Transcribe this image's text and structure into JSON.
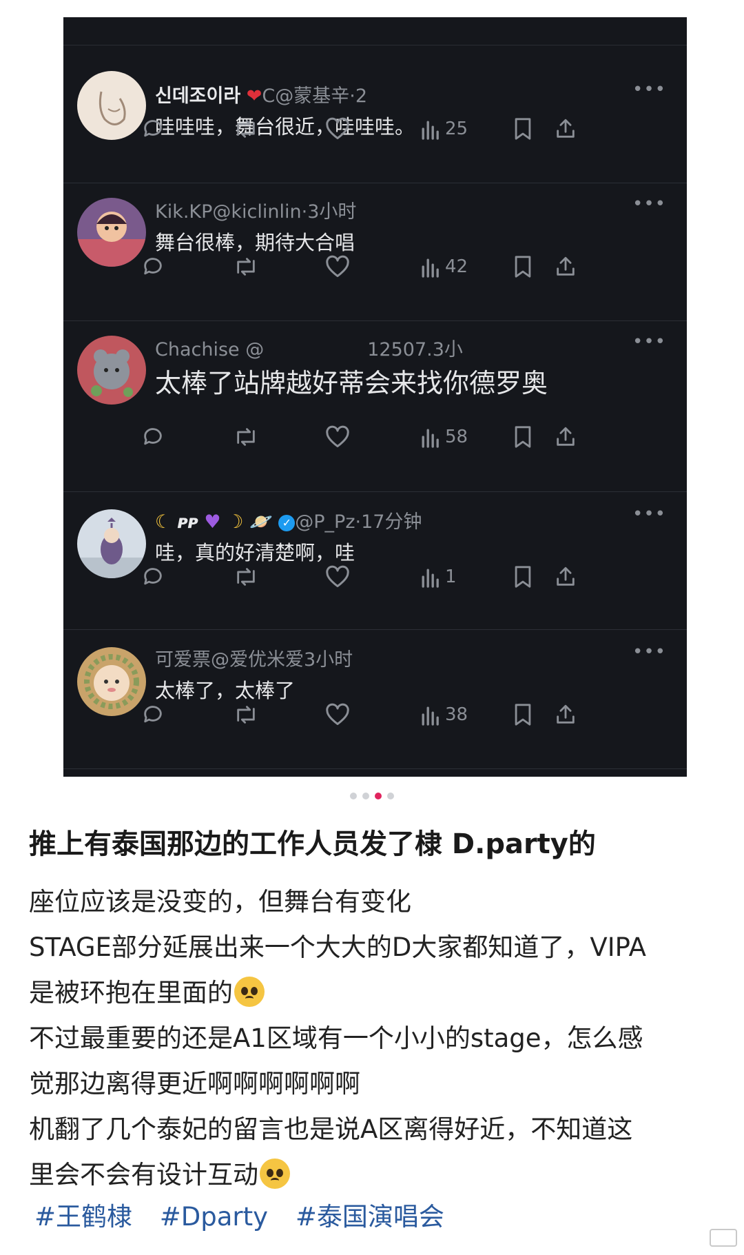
{
  "replies": [
    {
      "name": "신데조이라",
      "handle": "C@蒙基辛·2",
      "text": "哇哇哇，舞台很近，哇哇哇。",
      "views": "25"
    },
    {
      "name": "Kik.KP",
      "handle": "@kiclinlin·3小时",
      "text": "舞台很棒，期待大合唱",
      "views": "42"
    },
    {
      "name": "Chachise @",
      "handle": "12507.3小",
      "text": "太棒了站牌越好蒂会来找你德罗奥",
      "views": "58"
    },
    {
      "name": "ᴘᴘ",
      "handle": "@P_Pz·17分钟",
      "text": "哇，真的好清楚啊，哇",
      "views": "1"
    },
    {
      "name": "可爱票",
      "handle": "@爱优米爱3小时",
      "text": "太棒了，太棒了",
      "views": "38"
    }
  ],
  "more_label": "•••",
  "post": {
    "title": "推上有泰国那边的工作人员发了棣 D.party的",
    "lines": [
      "座位应该是没变的，但舞台有变化",
      "STAGE部分延展出来一个大大的D大家都知道了，VIPA",
      "是被环抱在里面的",
      "不过最重要的还是A1区域有一个小小的stage，怎么感",
      "觉那边离得更近啊啊啊啊啊啊",
      "机翻了几个泰妃的留言也是说A区离得好近，不知道这",
      "里会不会有设计互动"
    ],
    "tags": [
      "#王鹤棣",
      "#Dparty",
      "#泰国演唱会"
    ]
  },
  "colors": {
    "screenshot_bg": "#15171c",
    "muted_text": "#8b8f96",
    "tag_link": "#2a5a9e",
    "active_dot": "#e0245e"
  }
}
